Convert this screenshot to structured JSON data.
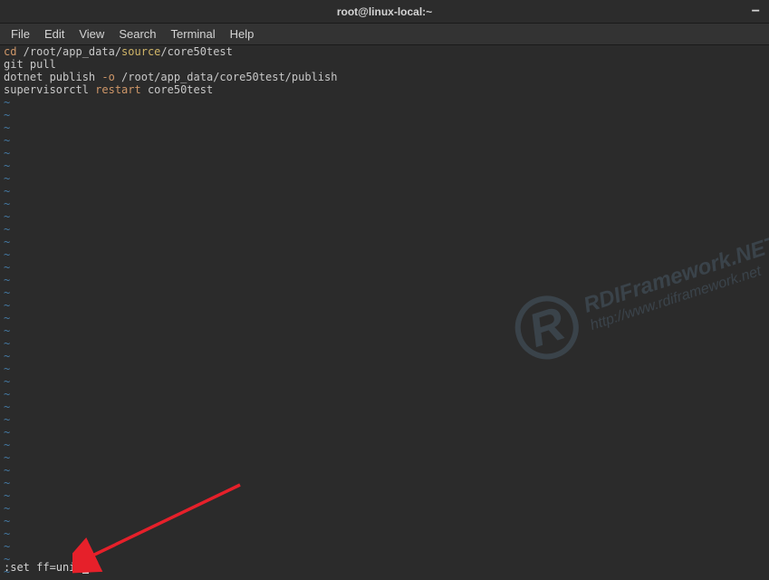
{
  "titlebar": {
    "title": "root@linux-local:~",
    "minimize": "−"
  },
  "menubar": {
    "file": "File",
    "edit": "Edit",
    "view": "View",
    "search": "Search",
    "terminal": "Terminal",
    "help": "Help"
  },
  "content": {
    "line1_cmd": "cd",
    "line1_path1": " /root/app_data/",
    "line1_source": "source",
    "line1_path2": "/core50test",
    "line2": "git pull",
    "line3_cmd": "dotnet publish ",
    "line3_flag": "-o",
    "line3_path": " /root/app_data/core50test/publish",
    "line4_cmd": "supervisorctl ",
    "line4_restart": "restart",
    "line4_svc": " core50test",
    "tilde": "~"
  },
  "cmdline": {
    "text": ":set ff=unix"
  },
  "watermark": {
    "logo": "R",
    "name": "RDIFramework.NET",
    "url": "http://www.rdiframework.net"
  }
}
